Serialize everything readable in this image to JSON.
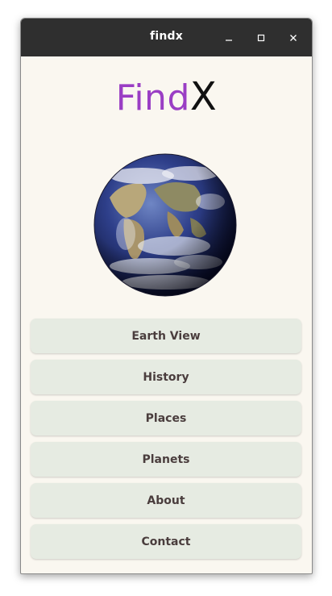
{
  "window": {
    "title": "findx",
    "controls": [
      {
        "name": "minimize",
        "icon": "minimize-icon"
      },
      {
        "name": "maximize",
        "icon": "maximize-icon"
      },
      {
        "name": "close",
        "icon": "close-icon"
      }
    ]
  },
  "logo": {
    "part1": "Find",
    "part2": "X",
    "part1_color": "#9a3ec4",
    "part2_color": "#111111"
  },
  "image": {
    "icon": "earth-globe-image"
  },
  "menu": {
    "items": [
      {
        "label": "Earth View"
      },
      {
        "label": "History"
      },
      {
        "label": "Places"
      },
      {
        "label": "Planets"
      },
      {
        "label": "About"
      },
      {
        "label": "Contact"
      }
    ]
  },
  "colors": {
    "titlebar": "#2f2f2f",
    "background": "#faf7f0",
    "button_bg": "#e6ebe2",
    "button_text": "#4a3d3d"
  }
}
